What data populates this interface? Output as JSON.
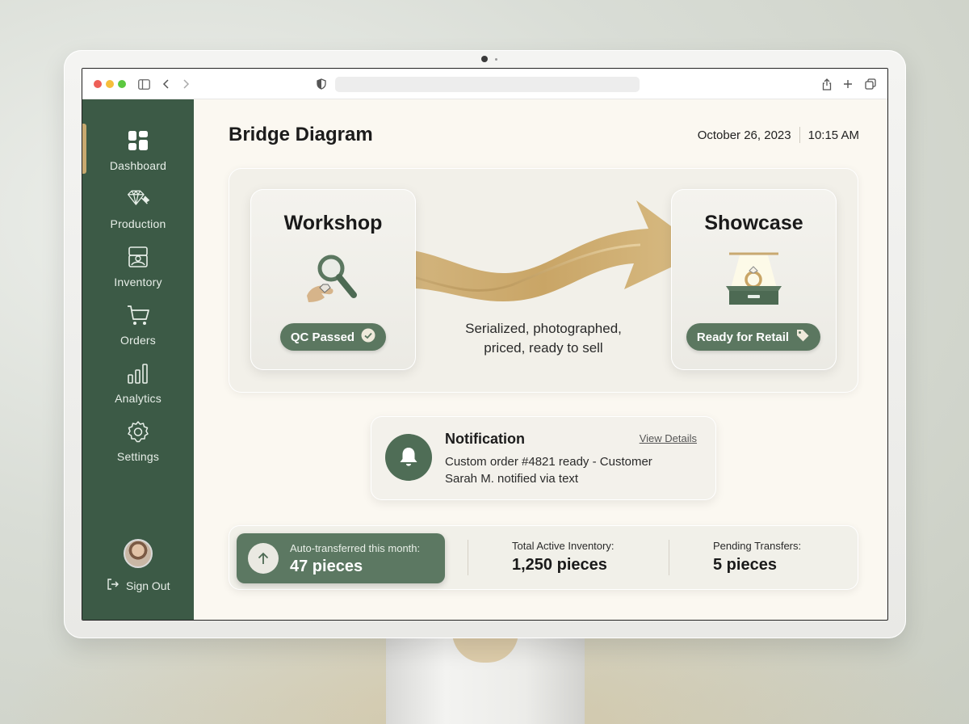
{
  "header": {
    "title": "Bridge Diagram",
    "date": "October 26, 2023",
    "time": "10:15 AM"
  },
  "sidebar": {
    "items": [
      {
        "label": "Dashboard",
        "icon": "dashboard-grid-icon",
        "active": true
      },
      {
        "label": "Production",
        "icon": "diamond-hammer-icon",
        "active": false
      },
      {
        "label": "Inventory",
        "icon": "jewelry-box-icon",
        "active": false
      },
      {
        "label": "Orders",
        "icon": "cart-icon",
        "active": false
      },
      {
        "label": "Analytics",
        "icon": "bar-chart-icon",
        "active": false
      },
      {
        "label": "Settings",
        "icon": "gear-icon",
        "active": false
      }
    ],
    "signout_label": "Sign Out"
  },
  "diagram": {
    "source": {
      "title": "Workshop",
      "badge": "QC Passed",
      "icon": "magnifier-gem-icon"
    },
    "target": {
      "title": "Showcase",
      "badge": "Ready for Retail",
      "icon": "ring-display-icon"
    },
    "caption_line1": "Serialized, photographed,",
    "caption_line2": "priced, ready to sell"
  },
  "notification": {
    "title": "Notification",
    "link": "View Details",
    "body": "Custom order #4821 ready - Customer Sarah M. notified via text"
  },
  "stats": {
    "auto_transferred": {
      "label": "Auto-transferred this month:",
      "value": "47 pieces"
    },
    "total_inventory": {
      "label": "Total Active Inventory:",
      "value": "1,250 pieces"
    },
    "pending": {
      "label": "Pending Transfers:",
      "value": "5 pieces"
    }
  },
  "colors": {
    "sidebar": "#3c5a46",
    "accent_green": "#5b7760",
    "gold": "#c9a970",
    "background": "#fbf8f1"
  }
}
